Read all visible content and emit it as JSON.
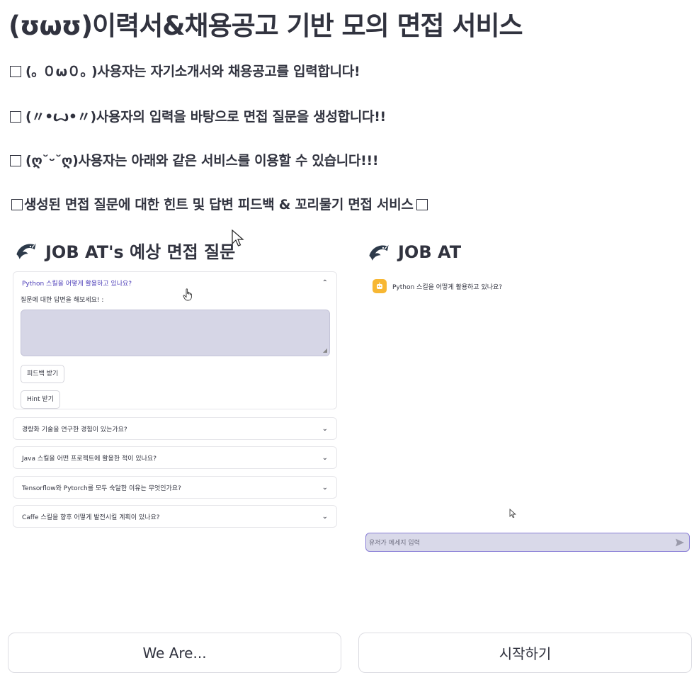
{
  "title": "(ʊωʊ)이력서&채용공고 기반 모의 면접 서비스",
  "intro": [
    "(｡ ０ω０｡ )사용자는 자기소개서와 채용공고를 입력합니다!",
    "(〃•ꙍ•〃)사용자의 입력을 바탕으로 면접 질문을 생성합니다!!",
    "(ღ˘ᵕ˘ღ)사용자는 아래와 같은 서비스를 이용할 수 있습니다!!!",
    "생성된 면접 질문에 대한 힌트 및 답변 피드백 & 꼬리물기 면접 서비스"
  ],
  "left": {
    "heading": "JOB AT's 예상 면접 질문",
    "open_question": "Python 스킬을 어떻게 활용하고 있나요?",
    "answer_label": "질문에 대한 답변을 해보세요! :",
    "feedback_btn": "피드백 받기",
    "hint_btn": "Hint 받기",
    "questions": [
      "경량화 기술을 연구한 경험이 있는가요?",
      "Java 스킬을 어떤 프로젝트에 활용한 적이 있나요?",
      "Tensorflow와 Pytorch를 모두 숙달한 이유는 무엇인가요?",
      "Caffe 스킬을 향후 어떻게 발전시킬 계획이 있나요?"
    ]
  },
  "right": {
    "heading": "JOB AT",
    "bot_message": "Python 스킬을 어떻게 활용하고 있나요?",
    "input_placeholder": "유저가 메세지 입력"
  },
  "buttons": {
    "we_are": "We Are...",
    "start": "시작하기"
  },
  "colors": {
    "text": "#31333f",
    "accent": "#4b3cb8",
    "input_bg": "#d6d6e6",
    "bot_avatar": "#f7b733"
  }
}
